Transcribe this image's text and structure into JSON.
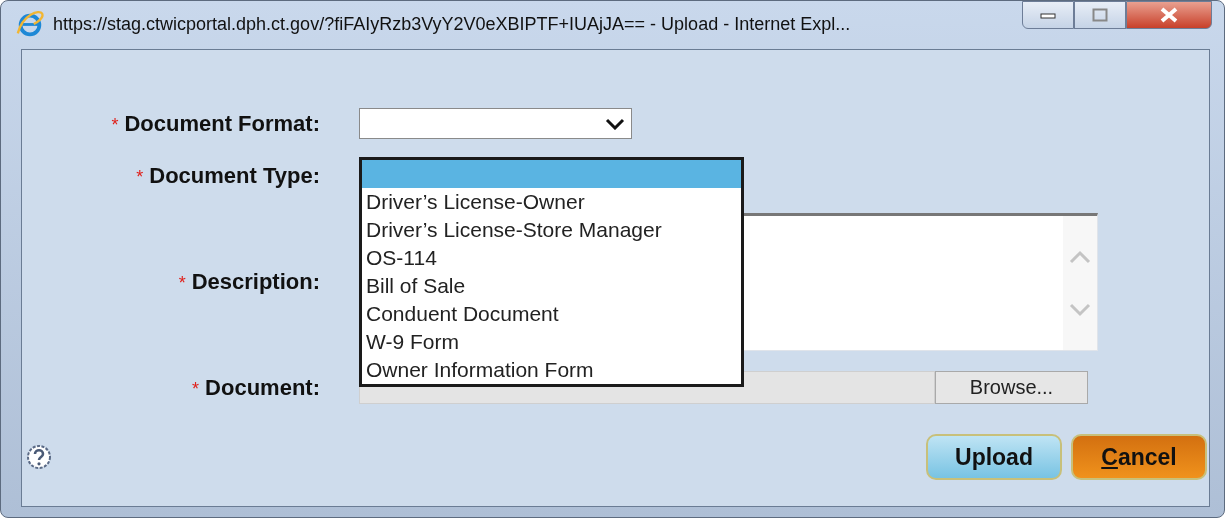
{
  "window": {
    "title": "https://stag.ctwicportal.dph.ct.gov/?fiFAIyRzb3VyY2V0eXBIPTF+IUAjJA== - Upload - Internet Expl..."
  },
  "form": {
    "fields": [
      {
        "kind": "select",
        "label": "Document Format:",
        "required_mark": "*"
      },
      {
        "kind": "dropdown-open",
        "label": "Document Type:",
        "required_mark": "*"
      },
      {
        "kind": "textarea",
        "label": "Description:",
        "required_mark": "*"
      },
      {
        "kind": "file",
        "label": "Document:",
        "required_mark": "*",
        "button": "Browse..."
      }
    ],
    "open_list": {
      "options": [
        {
          "selected": true
        },
        {
          "label": "Driver’s License-Owner",
          "selected": false
        },
        {
          "label": "Driver’s License-Store Manager",
          "selected": false
        },
        {
          "label": "OS-114",
          "selected": false
        },
        {
          "label": "Bill of Sale",
          "selected": false
        },
        {
          "label": "Conduent Document",
          "selected": false
        },
        {
          "label": "W-9 Form",
          "selected": false
        },
        {
          "label": "Owner Information Form",
          "selected": false
        }
      ]
    }
  },
  "buttons": [
    {
      "label": "Upload",
      "kind": "primary",
      "mnemonic_underlined": false
    },
    {
      "label": "Cancel",
      "kind": "cancel",
      "mnemonic_underlined": true
    }
  ]
}
